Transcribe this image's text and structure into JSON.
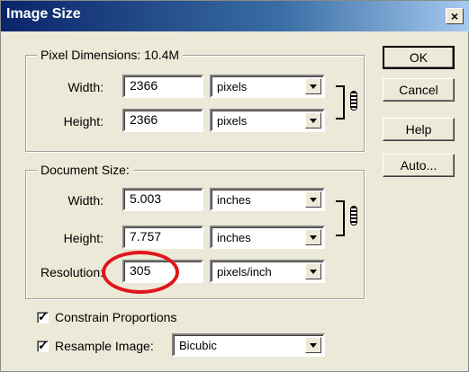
{
  "window": {
    "title": "Image Size",
    "close_label": "×"
  },
  "pixel_dimensions": {
    "legend": "Pixel Dimensions:  10.4M",
    "width_label": "Width:",
    "width_value": "2366",
    "width_unit": "pixels",
    "height_label": "Height:",
    "height_value": "2366",
    "height_unit": "pixels"
  },
  "document_size": {
    "legend": "Document Size:",
    "width_label": "Width:",
    "width_value": "5.003",
    "width_unit": "inches",
    "height_label": "Height:",
    "height_value": "7.757",
    "height_unit": "inches",
    "resolution_label": "Resolution:",
    "resolution_value": "305",
    "resolution_unit": "pixels/inch"
  },
  "options": {
    "constrain_label": "Constrain Proportions",
    "constrain_checked": true,
    "resample_label": "Resample Image:",
    "resample_checked": true,
    "resample_method": "Bicubic"
  },
  "buttons": {
    "ok": "OK",
    "cancel": "Cancel",
    "help": "Help",
    "auto": "Auto..."
  },
  "annotation": {
    "color": "#e0161c"
  }
}
